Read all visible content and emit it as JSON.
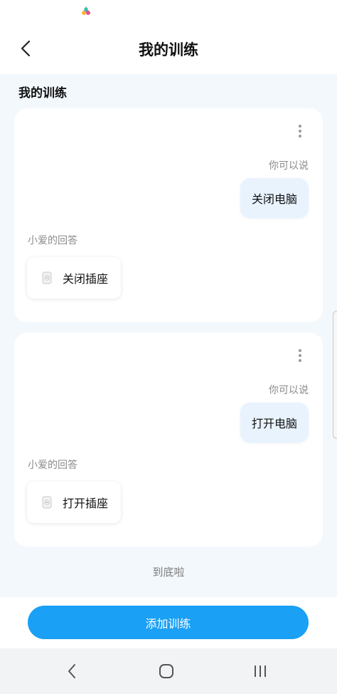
{
  "header": {
    "title": "我的训练",
    "back_icon": "back-arrow-icon"
  },
  "section": {
    "title": "我的训练"
  },
  "trainings": [
    {
      "prompt_label": "你可以说",
      "phrase": "关闭电脑",
      "reply_label": "小爱的回答",
      "device": "关闭插座"
    },
    {
      "prompt_label": "你可以说",
      "phrase": "打开电脑",
      "reply_label": "小爱的回答",
      "device": "打开插座"
    }
  ],
  "end_text": "到底啦",
  "footer": {
    "add_button": "添加训练"
  },
  "colors": {
    "accent": "#1aa0f5",
    "background": "#f3f8fd",
    "bubble": "#e8f3fd"
  }
}
